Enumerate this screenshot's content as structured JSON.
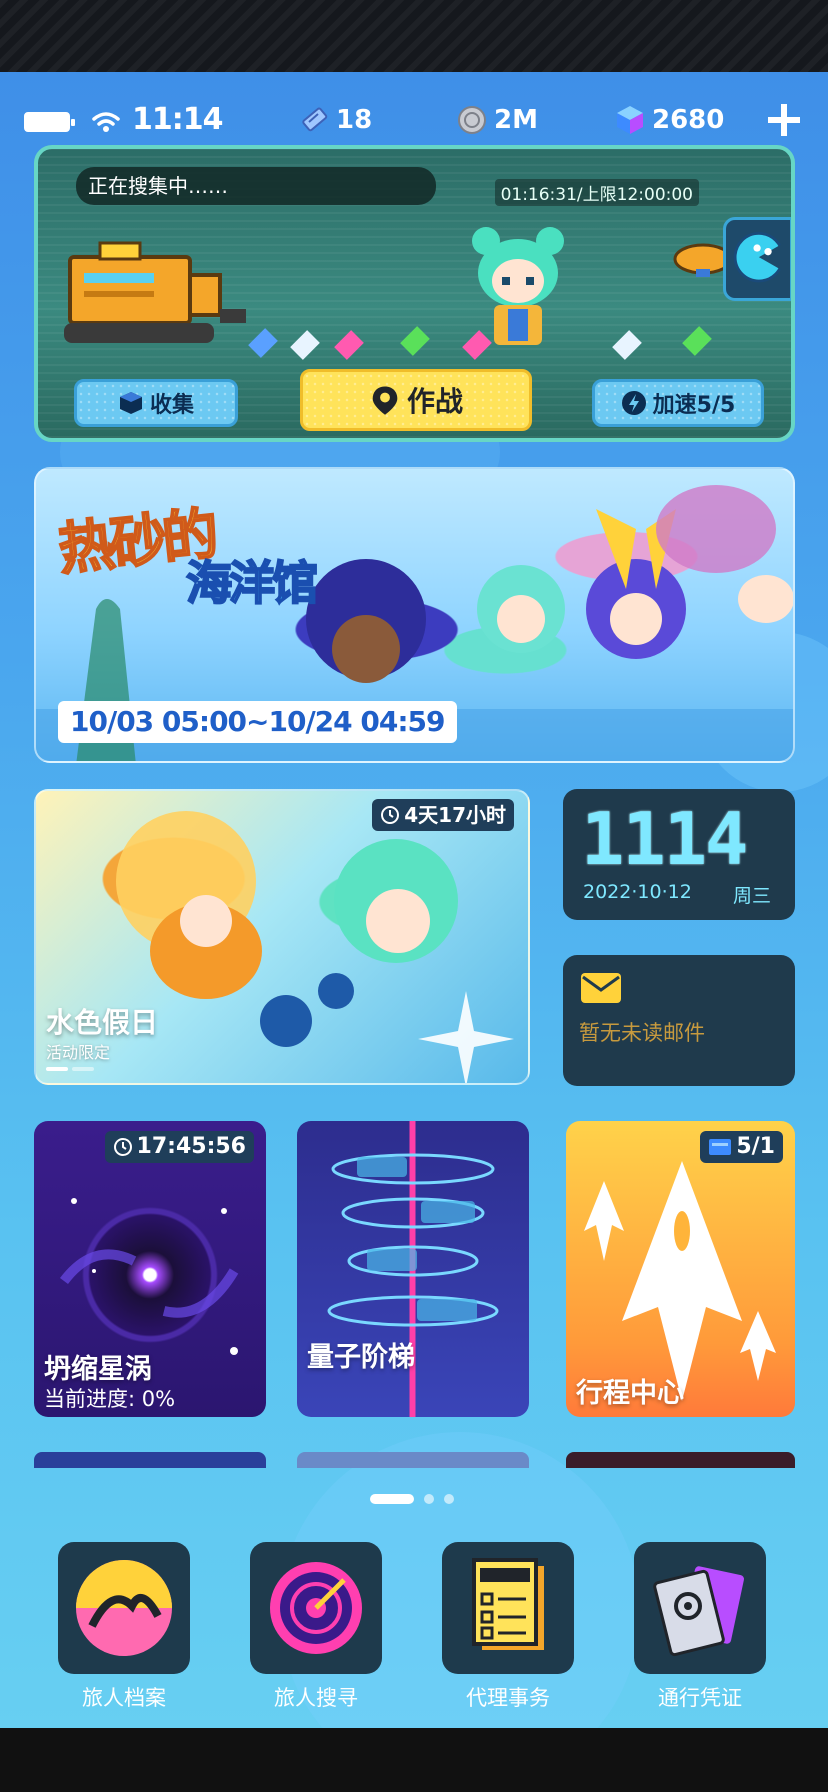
{
  "status_bar": {
    "time": "11:14",
    "resources": [
      {
        "icon": "ticket-icon",
        "value": "18"
      },
      {
        "icon": "coin-icon",
        "value": "2M"
      },
      {
        "icon": "gem-cube-icon",
        "value": "2680"
      }
    ]
  },
  "collect": {
    "status": "正在搜集中……",
    "timer": "01:16:31/上限12:00:00",
    "collect_label": "收集",
    "battle_label": "作战",
    "boost_label": "加速5/5"
  },
  "banner": {
    "title_line1": "热砂的",
    "title_line2": "海洋馆",
    "date_range": "10/03 05:00~10/24 04:59"
  },
  "event": {
    "timer": "4天17小时",
    "title": "水色假日",
    "subtitle": "活动限定"
  },
  "clock_widget": {
    "time": "1114",
    "date": "2022·10·12",
    "weekday": "周三"
  },
  "mail_widget": {
    "text": "暂无未读邮件"
  },
  "cards": {
    "vortex": {
      "timer": "17:45:56",
      "title": "坍缩星涡",
      "progress": "当前进度:  0%"
    },
    "ladder": {
      "title": "量子阶梯"
    },
    "trip": {
      "badge": "5/1",
      "title": "行程中心"
    }
  },
  "dock": [
    {
      "label": "旅人档案",
      "icon": "archive-icon"
    },
    {
      "label": "旅人搜寻",
      "icon": "radar-icon"
    },
    {
      "label": "代理事务",
      "icon": "task-icon"
    },
    {
      "label": "通行凭证",
      "icon": "pass-card-icon"
    }
  ],
  "colors": {
    "accent_yellow": "#ffe35a",
    "accent_blue": "#6cc9f2",
    "widget_bg": "#1f3a4c",
    "clock_cyan": "#7fe8ff"
  }
}
